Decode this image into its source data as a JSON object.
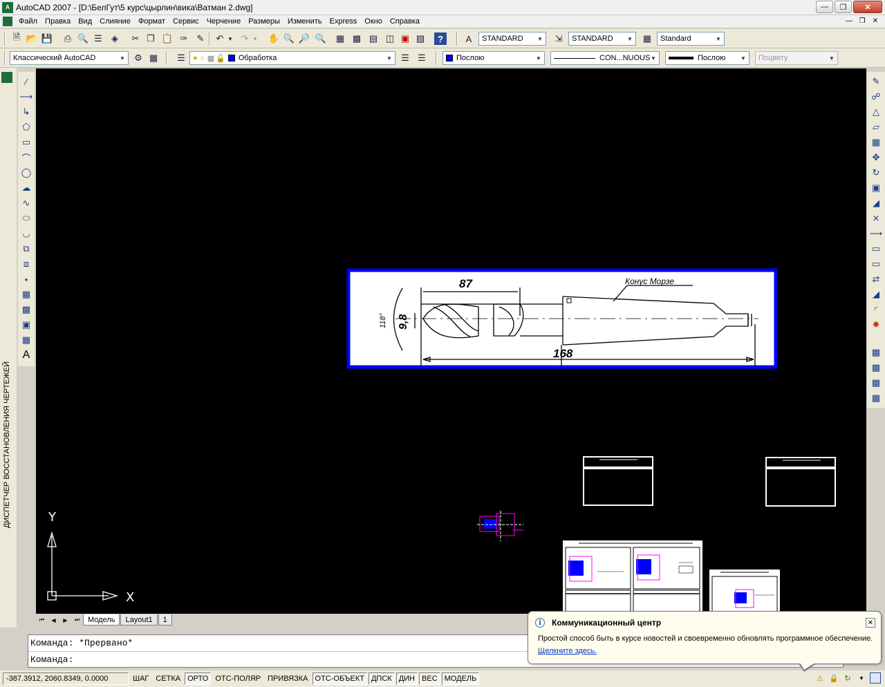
{
  "window": {
    "title": "AutoCAD 2007 - [D:\\БелГут\\5 курс\\цырлин\\вика\\Ватман 2.dwg]"
  },
  "menu": [
    "Файл",
    "Правка",
    "Вид",
    "Слияние",
    "Формат",
    "Сервис",
    "Черчение",
    "Размеры",
    "Изменить",
    "Express",
    "Окно",
    "Справка"
  ],
  "toolbar1": {
    "text_style": "STANDARD",
    "dim_style": "STANDARD",
    "table_style": "Standard"
  },
  "toolbar2": {
    "workspace": "Классический AutoCAD",
    "layer": "Обработка",
    "color": "Послою",
    "linetype": "CON...NUOUS",
    "lineweight": "Послою",
    "plotstyle": "Поцвету"
  },
  "side_panel": {
    "label": "ДИСПЕТЧЕР ВОССТАНОВЛЕНИЯ ЧЕРТЕЖЕЙ"
  },
  "drawing": {
    "dim_top": "87",
    "dim_bottom": "168",
    "dim_diameter": "9,8",
    "dim_angle": "118°",
    "cone_label": "Конус  Морзе",
    "ucs_y": "Y",
    "ucs_x": "X"
  },
  "layout_tabs": [
    "Модель",
    "Layout1",
    "1"
  ],
  "command": {
    "line1": "Команда: *Прервано*",
    "line2": "Команда:"
  },
  "status": {
    "coords": "-387.3912, 2060.8349, 0.0000",
    "buttons": [
      {
        "label": "ШАГ",
        "on": false
      },
      {
        "label": "СЕТКА",
        "on": false
      },
      {
        "label": "ОРТО",
        "on": true
      },
      {
        "label": "ОТС-ПОЛЯР",
        "on": false
      },
      {
        "label": "ПРИВЯЗКА",
        "on": false
      },
      {
        "label": "ОТС-ОБЪЕКТ",
        "on": true
      },
      {
        "label": "ДПСК",
        "on": true
      },
      {
        "label": "ДИН",
        "on": true
      },
      {
        "label": "ВЕС",
        "on": true
      },
      {
        "label": "МОДЕЛЬ",
        "on": true
      }
    ]
  },
  "notification": {
    "title": "Коммуникационный центр",
    "text": "Простой способ быть в курсе новостей и своевременно обновлять программное обеспечение.",
    "link": "Щелкните здесь."
  },
  "colors": {
    "accent_blue": "#0000ff",
    "canvas": "#000000",
    "magenta": "#ff00ff"
  }
}
